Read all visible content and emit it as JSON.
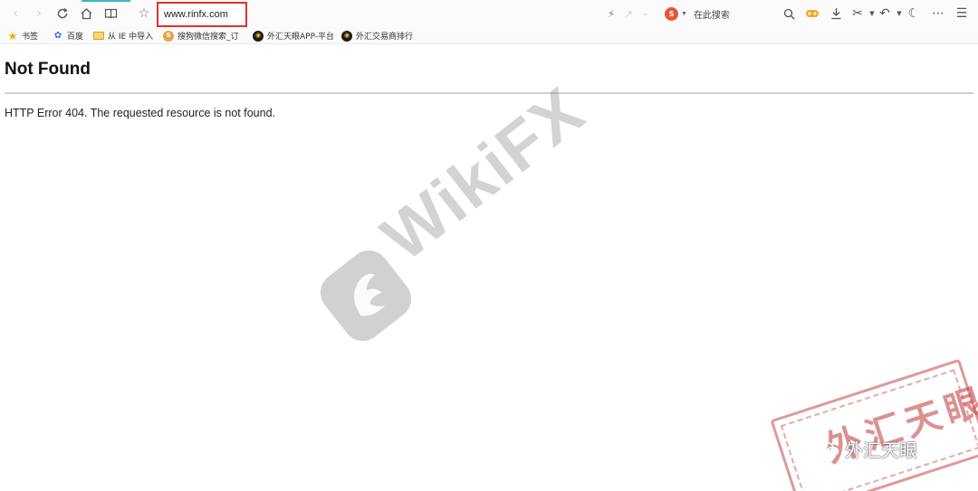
{
  "browser": {
    "address_bar": {
      "url": "www.rinfx.com"
    },
    "search_box": {
      "engine_icon": "sogou-logo-icon",
      "placeholder": "在此搜索"
    },
    "toolbar_icons": [
      "back-icon",
      "forward-icon",
      "reload-icon",
      "home-icon",
      "reading-view-icon",
      "favorite-star-icon",
      "flash-icon",
      "share-icon",
      "chevron-down-icon",
      "magnifier-icon",
      "game-icon",
      "download-icon",
      "scissors-icon",
      "undo-icon",
      "night-mode-icon",
      "more-icon",
      "menu-icon"
    ],
    "accent_color": "#d9342b"
  },
  "bookmarks": [
    {
      "icon": "star-icon",
      "label": "书签"
    },
    {
      "icon": "baidu-paw-icon",
      "label": "百度"
    },
    {
      "icon": "folder-icon",
      "label": "从 IE 中导入"
    },
    {
      "icon": "sogou-icon",
      "label": "搜狗微信搜索_订"
    },
    {
      "icon": "fx-eye-icon",
      "label": "外汇天眼APP-平台"
    },
    {
      "icon": "fx-eye-icon",
      "label": "外汇交易商排行"
    }
  ],
  "page": {
    "title": "Not Found",
    "message": "HTTP Error 404. The requested resource is not found."
  },
  "watermark": {
    "text": "WikiFX"
  },
  "stamp": {
    "text": "外汇天眼",
    "wechat_label": "外汇天眼"
  }
}
